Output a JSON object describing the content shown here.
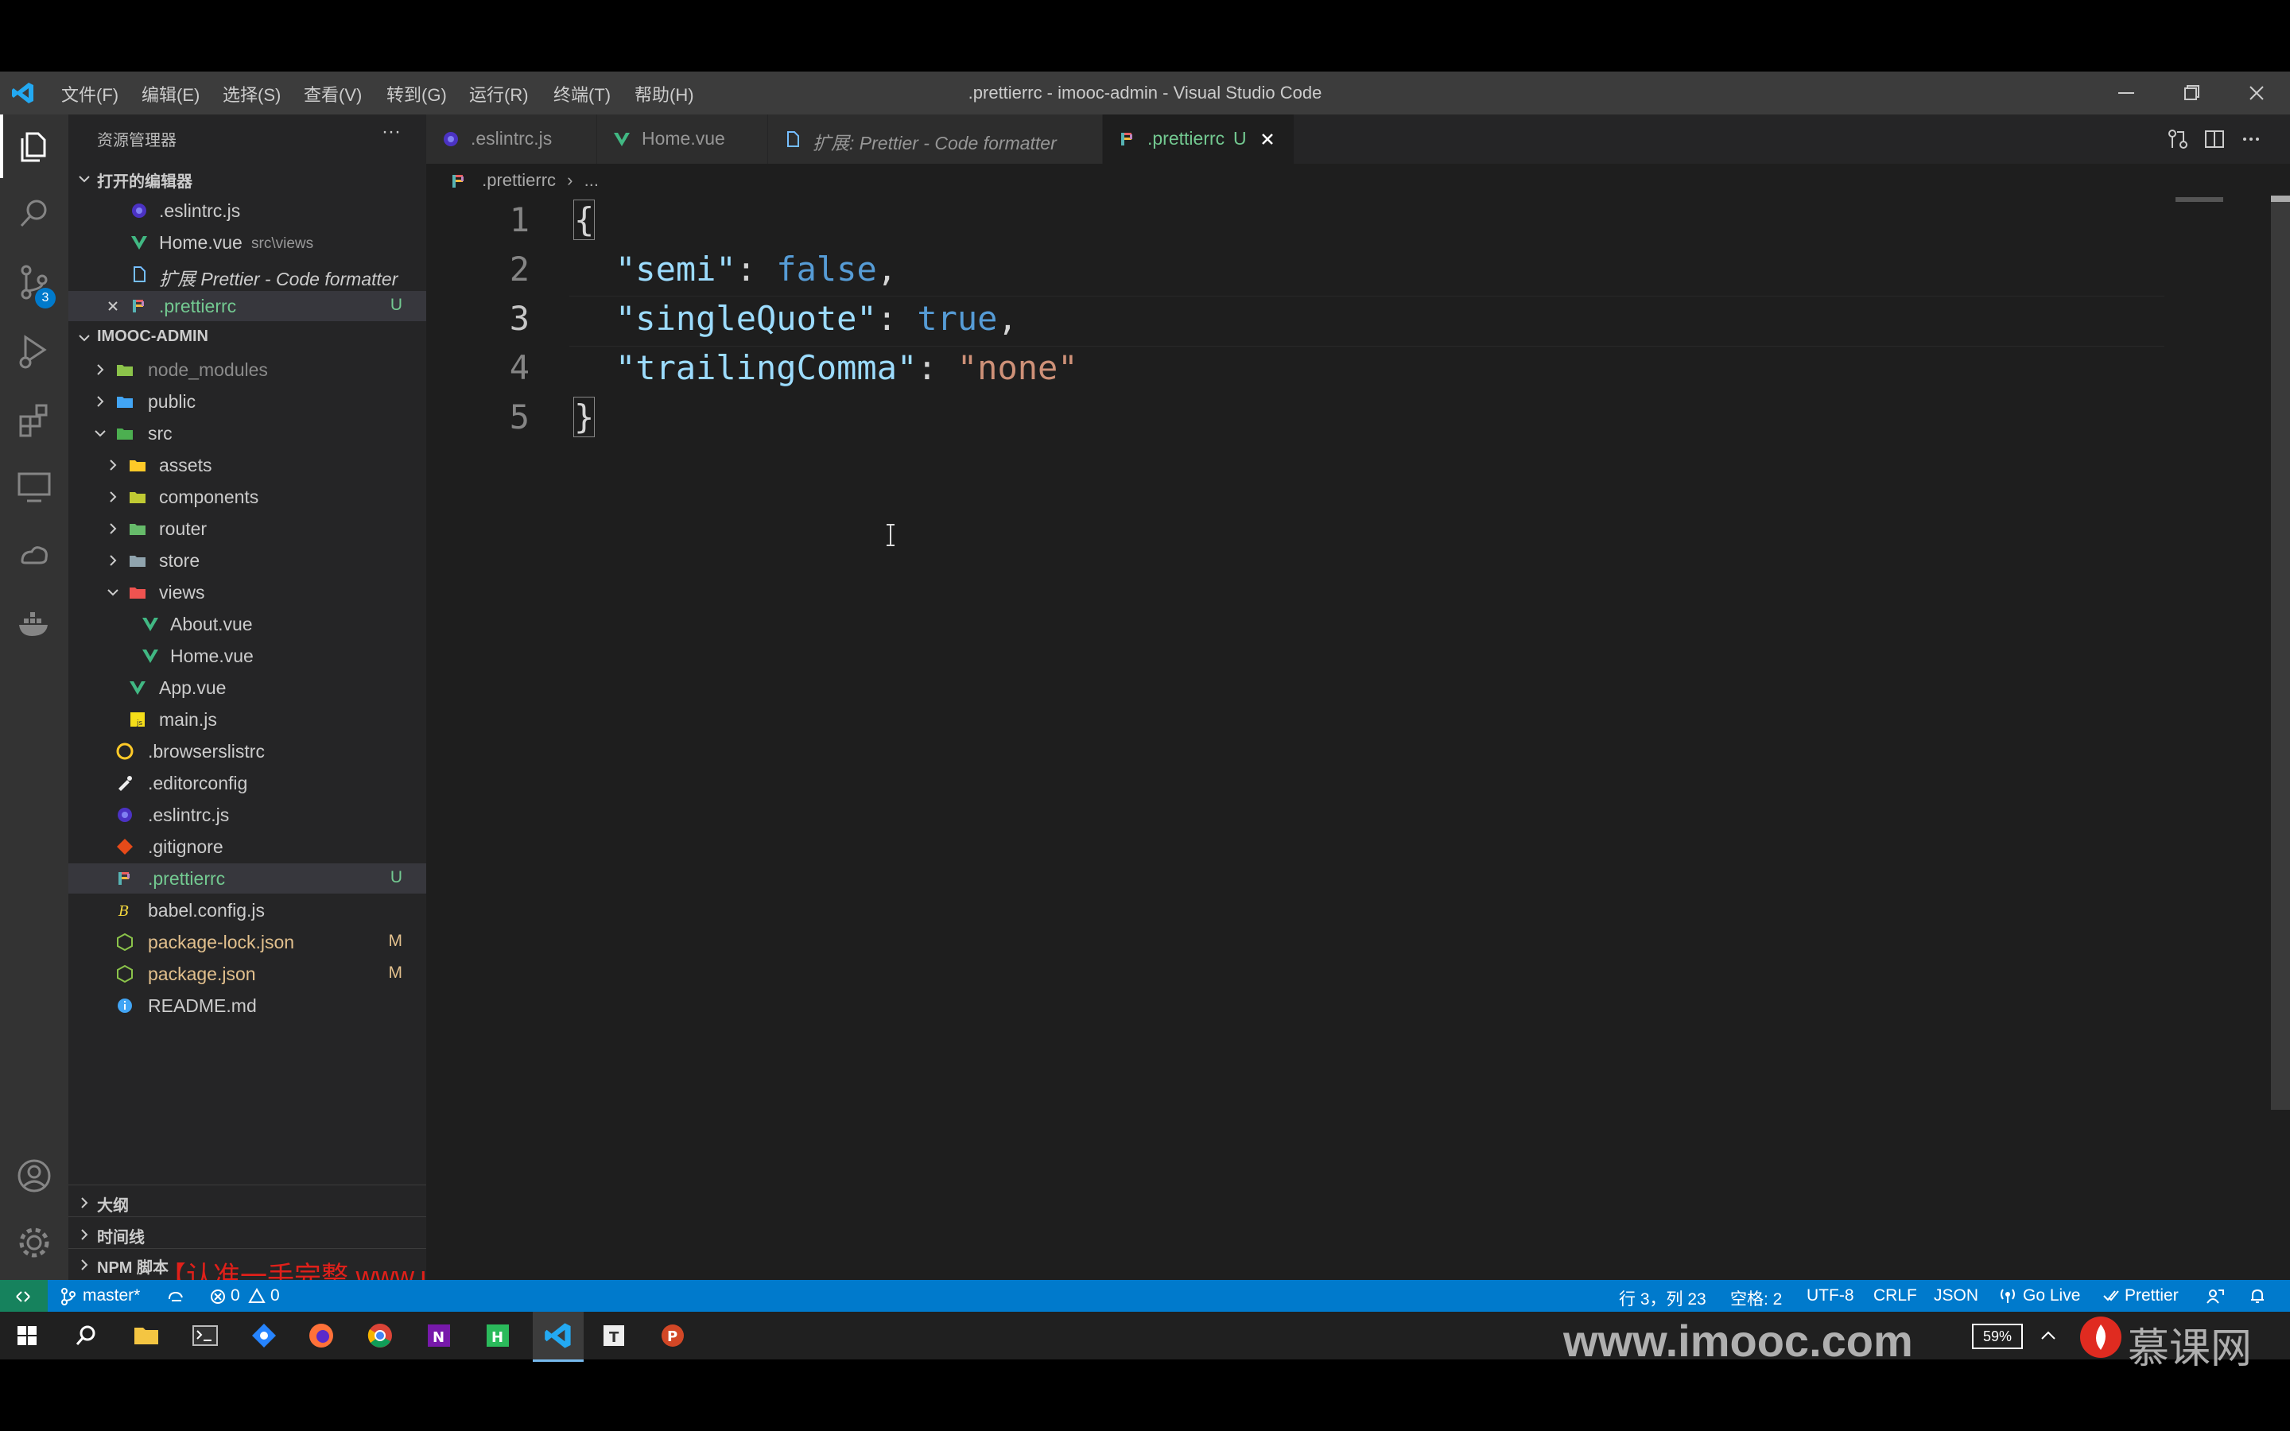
{
  "window": {
    "title": ".prettierrc - imooc-admin - Visual Studio Code",
    "menu": [
      "文件(F)",
      "编辑(E)",
      "选择(S)",
      "查看(V)",
      "转到(G)",
      "运行(R)",
      "终端(T)",
      "帮助(H)"
    ]
  },
  "activity": {
    "scm_badge": "3"
  },
  "sidebar": {
    "header": "资源管理器",
    "more": "···",
    "open_editors_title": "打开的编辑器",
    "open_editors": [
      {
        "name": ".eslintrc.js",
        "path": ""
      },
      {
        "name": "Home.vue",
        "path": "src\\views"
      },
      {
        "name": "扩展 Prettier - Code formatter",
        "path": ""
      },
      {
        "name": ".prettierrc",
        "path": "",
        "badge": "U"
      }
    ],
    "project_title": "IMOOC-ADMIN",
    "tree": [
      {
        "name": "node_modules"
      },
      {
        "name": "public"
      },
      {
        "name": "src"
      },
      {
        "name": "assets"
      },
      {
        "name": "components"
      },
      {
        "name": "router"
      },
      {
        "name": "store"
      },
      {
        "name": "views"
      },
      {
        "name": "About.vue"
      },
      {
        "name": "Home.vue"
      },
      {
        "name": "App.vue"
      },
      {
        "name": "main.js"
      },
      {
        "name": ".browserslistrc"
      },
      {
        "name": ".editorconfig"
      },
      {
        "name": ".eslintrc.js"
      },
      {
        "name": ".gitignore"
      },
      {
        "name": ".prettierrc",
        "badge": "U"
      },
      {
        "name": "babel.config.js"
      },
      {
        "name": "package-lock.json",
        "badge": "M"
      },
      {
        "name": "package.json",
        "badge": "M"
      },
      {
        "name": "README.md"
      }
    ],
    "outline": "大纲",
    "timeline": "时间线",
    "npm": "NPM 脚本"
  },
  "tabs": [
    {
      "label": ".eslintrc.js"
    },
    {
      "label": "Home.vue"
    },
    {
      "label": "扩展: Prettier - Code formatter"
    },
    {
      "label": ".prettierrc",
      "badge": "U"
    }
  ],
  "breadcrumb": {
    "file": ".prettierrc",
    "more": "..."
  },
  "code": {
    "line_numbers": [
      "1",
      "2",
      "3",
      "4",
      "5"
    ],
    "l1": "{",
    "l2_key": "\"semi\"",
    "l2_sep": ": ",
    "l2_val": "false",
    "l2_end": ",",
    "l3_key": "\"singleQuote\"",
    "l3_sep": ": ",
    "l3_val": "true",
    "l3_end": ",",
    "l4_key": "\"trailingComma\"",
    "l4_sep": ": ",
    "l4_val": "\"none\"",
    "l5": "}"
  },
  "watermark_overlay": "【认准一手完整 www.ukoou.com】",
  "statusbar": {
    "branch": "master*",
    "errors": "0",
    "warnings": "0",
    "position": "行 3，列 23",
    "spaces": "空格: 2",
    "encoding": "UTF-8",
    "eol": "CRLF",
    "language": "JSON",
    "golive": "Go Live",
    "prettier": "Prettier"
  },
  "taskbar": {
    "battery": "59%"
  },
  "brand": {
    "url": "www.imooc.com",
    "name": "慕课网"
  }
}
